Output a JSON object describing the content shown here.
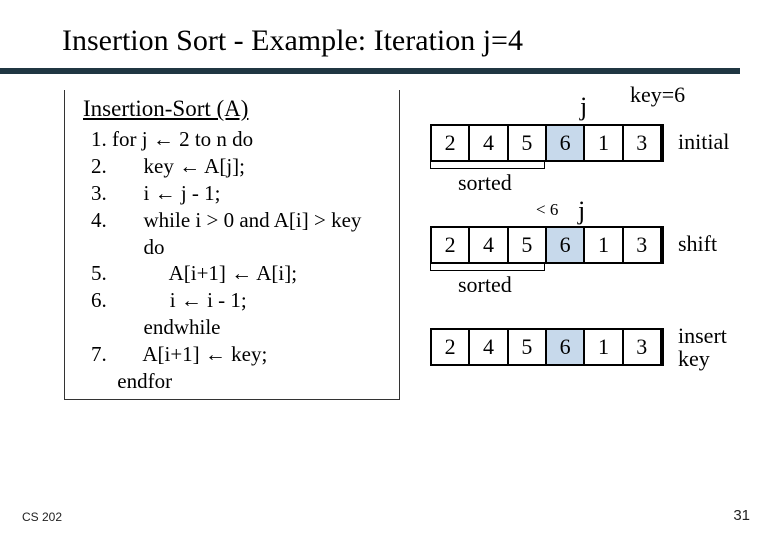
{
  "title": "Insertion Sort - Example: Iteration j=4",
  "algoTitle": "Insertion-Sort (A)",
  "lines": {
    "l1": "1. for j ← 2 to n do",
    "l2": "2.       key ← A[j];",
    "l3": "3.       i ← j - 1;",
    "l4": "4.       while i > 0 and A[i] > key",
    "l4b": "          do",
    "l5": "5.            A[i+1] ← A[i];",
    "l6": "6.            i ← i - 1;",
    "l6b": "          endwhile",
    "l7": "7.       A[i+1] ← key;",
    "l7b": "     endfor"
  },
  "jLabel": "j",
  "keyLabel": "key=6",
  "lt6": "< 6",
  "sorted": "sorted",
  "labels": {
    "initial": "initial",
    "shift": "shift",
    "insert": "insert\nkey"
  },
  "arr": {
    "a": [
      "2",
      "4",
      "5",
      "6",
      "1",
      "3"
    ],
    "b": [
      "2",
      "4",
      "5",
      "6",
      "1",
      "3"
    ],
    "c": [
      "2",
      "4",
      "5",
      "6",
      "1",
      "3"
    ]
  },
  "footer": {
    "left": "CS 202",
    "right": "31"
  },
  "chart_data": {
    "type": "table",
    "title": "Insertion Sort iteration j=4, key=6",
    "series": [
      {
        "name": "initial",
        "values": [
          2,
          4,
          5,
          6,
          1,
          3
        ],
        "highlight_index": 3,
        "sorted_prefix": 3
      },
      {
        "name": "shift",
        "values": [
          2,
          4,
          5,
          6,
          1,
          3
        ],
        "highlight_index": 3,
        "sorted_prefix": 3,
        "compare": "<6"
      },
      {
        "name": "insert key",
        "values": [
          2,
          4,
          5,
          6,
          1,
          3
        ],
        "highlight_index": 3,
        "sorted_prefix": 4
      }
    ]
  }
}
